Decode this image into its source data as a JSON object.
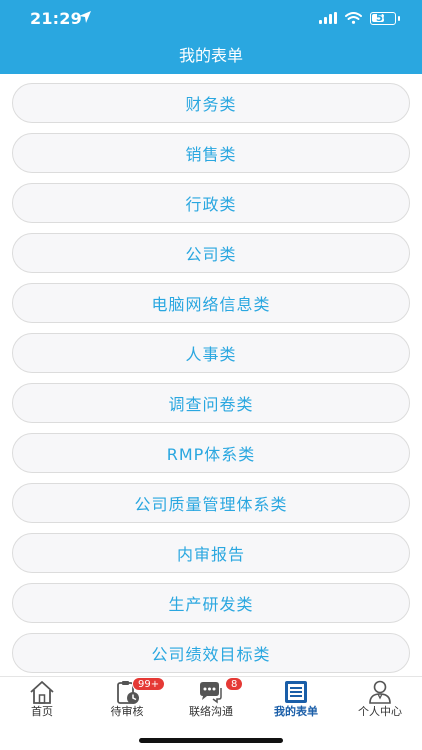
{
  "status_bar": {
    "time": "21:29",
    "battery_level": "56"
  },
  "header": {
    "title": "我的表单"
  },
  "menu": {
    "items": [
      {
        "label": "财务类"
      },
      {
        "label": "销售类"
      },
      {
        "label": "行政类"
      },
      {
        "label": "公司类"
      },
      {
        "label": "电脑网络信息类"
      },
      {
        "label": "人事类"
      },
      {
        "label": "调查问卷类"
      },
      {
        "label": "RMP体系类"
      },
      {
        "label": "公司质量管理体系类"
      },
      {
        "label": "内审报告"
      },
      {
        "label": "生产研发类"
      },
      {
        "label": "公司绩效目标类"
      }
    ]
  },
  "tabbar": {
    "tabs": [
      {
        "label": "首页",
        "icon": "home-icon"
      },
      {
        "label": "待审核",
        "icon": "clipboard-clock-icon",
        "badge": "99+"
      },
      {
        "label": "联络沟通",
        "icon": "chat-icon",
        "badge": "8"
      },
      {
        "label": "我的表单",
        "icon": "list-form-icon",
        "active": true
      },
      {
        "label": "个人中心",
        "icon": "user-icon"
      }
    ]
  },
  "colors": {
    "primary": "#2aa7e0",
    "active_tab": "#1a5ea8",
    "badge": "#e53935"
  }
}
